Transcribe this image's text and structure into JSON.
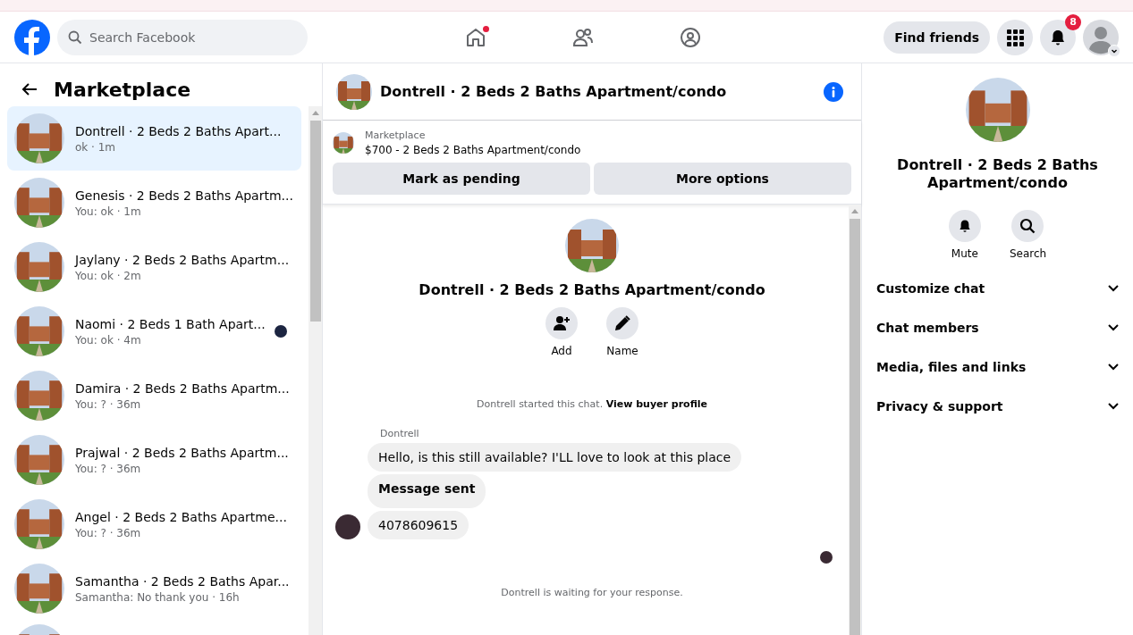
{
  "header": {
    "search": {
      "placeholder": "Search Facebook"
    },
    "nav": [
      {
        "kind": "home",
        "selected": false,
        "dot": true
      },
      {
        "kind": "friends",
        "selected": false,
        "dot": false
      },
      {
        "kind": "groups",
        "selected": false,
        "dot": false
      }
    ],
    "find_friends": "Find friends",
    "notification_count": "8"
  },
  "sidebar": {
    "title": "Marketplace",
    "conversations": [
      {
        "title": "Dontrell · 2 Beds 2 Baths Apart...",
        "preview": "ok · 1m",
        "selected": true,
        "read_receipt": false
      },
      {
        "title": "Genesis · 2 Beds 2 Baths Apartm...",
        "preview": "You: ok · 1m",
        "selected": false,
        "read_receipt": false
      },
      {
        "title": "Jaylany · 2 Beds 2 Baths Apartm...",
        "preview": "You: ok · 2m",
        "selected": false,
        "read_receipt": false
      },
      {
        "title": "Naomi · 2 Beds 1 Bath Apart...",
        "preview": "You: ok · 4m",
        "selected": false,
        "read_receipt": true
      },
      {
        "title": "Damira · 2 Beds 2 Baths Apartm...",
        "preview": "You: ? · 36m",
        "selected": false,
        "read_receipt": false
      },
      {
        "title": "Prajwal · 2 Beds 2 Baths Apartm...",
        "preview": "You: ? · 36m",
        "selected": false,
        "read_receipt": false
      },
      {
        "title": "Angel · 2 Beds 2 Baths Apartme...",
        "preview": "You: ? · 36m",
        "selected": false,
        "read_receipt": false
      },
      {
        "title": "Samantha · 2 Beds 2 Baths Apar...",
        "preview": "Samantha: No thank you · 16h",
        "selected": false,
        "read_receipt": false
      }
    ]
  },
  "chat": {
    "title": "Dontrell · 2 Beds 2 Baths Apartment/condo",
    "listing": {
      "source": "Marketplace",
      "description": "$700 - 2 Beds 2 Baths Apartment/condo"
    },
    "actions": [
      "Mark as pending",
      "More options"
    ],
    "intro": {
      "title": "Dontrell · 2 Beds 2 Baths Apartment/condo",
      "buttons": [
        {
          "kind": "add",
          "label": "Add"
        },
        {
          "kind": "name",
          "label": "Name"
        }
      ]
    },
    "started_note": "Dontrell started this chat.",
    "buyer_profile_link": "View buyer profile",
    "sender": "Dontrell",
    "messages": [
      {
        "kind": "text",
        "text": "Hello, is this still available? I'LL love to look at this place"
      },
      {
        "kind": "bold",
        "text": "Message sent"
      },
      {
        "kind": "text",
        "text": "4078609615"
      }
    ],
    "waiting_note": "Dontrell is waiting for your response."
  },
  "details": {
    "title": "Dontrell · 2 Beds 2 Baths Apartment/condo",
    "buttons": [
      {
        "kind": "mute",
        "label": "Mute"
      },
      {
        "kind": "search",
        "label": "Search"
      }
    ],
    "sections": [
      {
        "label": "Customize chat",
        "expanded": false
      },
      {
        "label": "Chat members",
        "expanded": false
      },
      {
        "label": "Media, files and links",
        "expanded": false
      },
      {
        "label": "Privacy & support",
        "expanded": false
      }
    ]
  }
}
